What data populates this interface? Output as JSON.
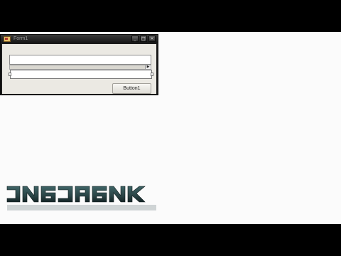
{
  "window": {
    "title": "Form1",
    "controls": {
      "minimize": "_",
      "maximize": "□",
      "close": "×"
    }
  },
  "form": {
    "textbox_value": "",
    "selected_textbox_value": "",
    "scroll_arrow": "▶",
    "button_label": "Button1"
  },
  "watermark": {
    "text": "JNBJABNK",
    "color": "#2e4a4c"
  }
}
